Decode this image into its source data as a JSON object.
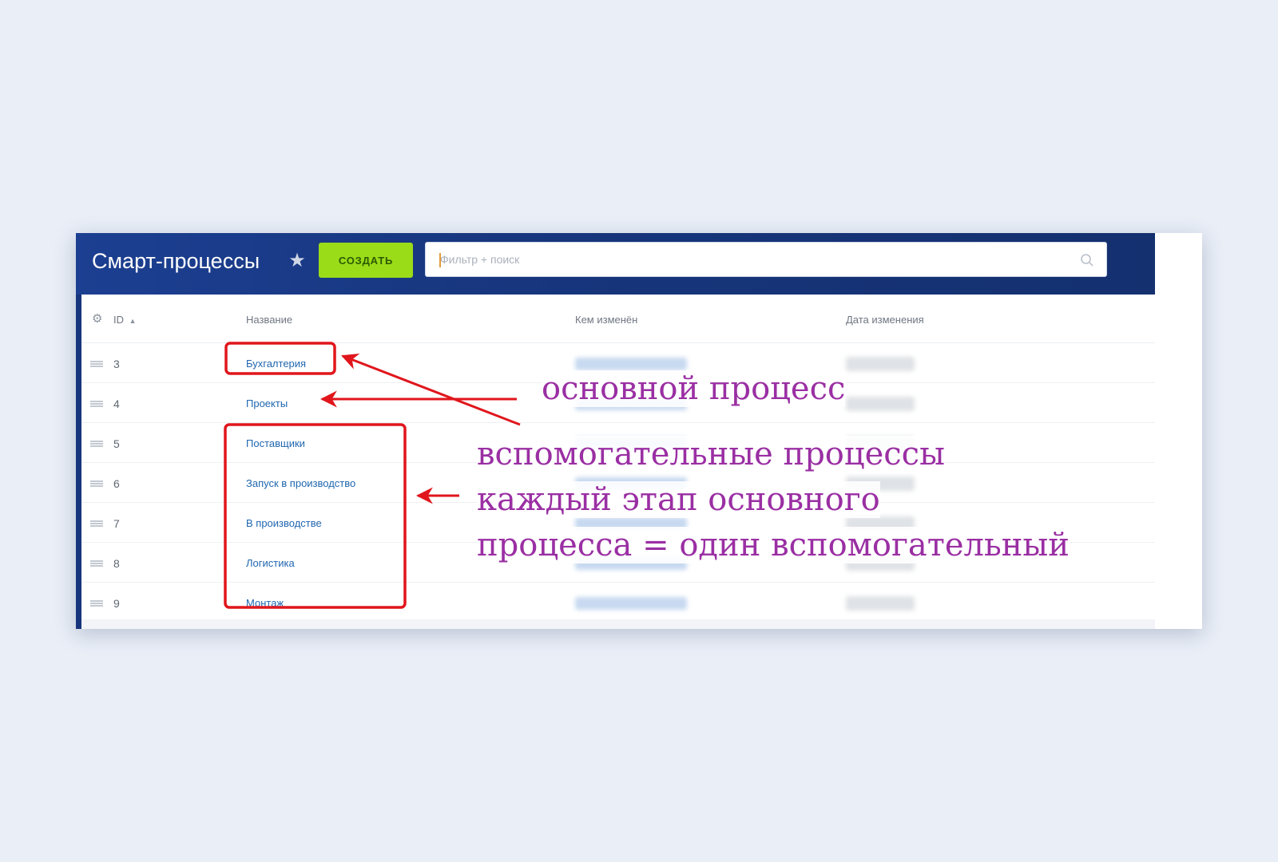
{
  "header": {
    "title": "Смарт-процессы",
    "star_icon": "star-icon",
    "create_label": "СОЗДАТЬ",
    "search_placeholder": "Фильтр + поиск",
    "search_icon": "search-icon",
    "colors": {
      "header_bg": "#1c3f91",
      "create_bg": "#9bdc18",
      "link": "#2067b0",
      "annotation": "#9a2fa3",
      "highlight": "#e0161c"
    }
  },
  "table": {
    "settings_icon": "gear-icon",
    "columns": {
      "id": "ID",
      "name": "Название",
      "modified_by": "Кем изменён",
      "modified_date": "Дата изменения"
    },
    "rows": [
      {
        "id": "3",
        "name": "Бухгалтерия"
      },
      {
        "id": "4",
        "name": "Проекты"
      },
      {
        "id": "5",
        "name": "Поставщики"
      },
      {
        "id": "6",
        "name": "Запуск в производство"
      },
      {
        "id": "7",
        "name": "В производстве"
      },
      {
        "id": "8",
        "name": "Логистика"
      },
      {
        "id": "9",
        "name": "Монтаж"
      }
    ]
  },
  "annotations": {
    "main_process": "основной процесс",
    "aux_line1": "вспомогательные процессы",
    "aux_line2": "каждый этап основного",
    "aux_line3": "процесса = один вспомогательный"
  }
}
